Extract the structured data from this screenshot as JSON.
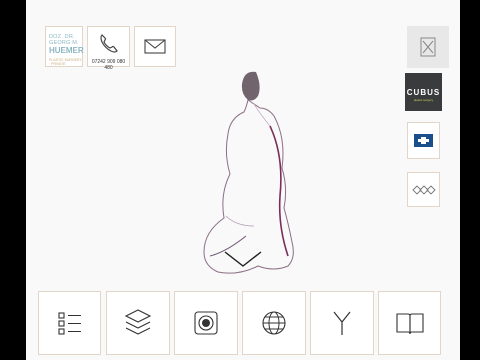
{
  "header": {
    "logo": {
      "line1": "DOZ. DR.",
      "line2": "GEORG M.",
      "line3": "HUEMER",
      "tagline": "PLASTIC SURGERY · PRIVATE"
    },
    "phone_number": "07242 909 080 480"
  },
  "sidebar_right": {
    "close_icon": "close-icon",
    "brands": [
      {
        "name": "CUBUS",
        "subtitle": "plastic surgery"
      },
      {
        "icon": "cross-badge-icon"
      },
      {
        "icon": "diamonds-logo-icon"
      }
    ]
  },
  "bottom_nav": [
    {
      "icon": "list-icon"
    },
    {
      "icon": "layers-icon"
    },
    {
      "icon": "record-icon"
    },
    {
      "icon": "globe-icon"
    },
    {
      "icon": "fork-icon"
    },
    {
      "icon": "book-icon"
    }
  ],
  "colors": {
    "tile_border": "#e3d6c8",
    "accent_blue": "#8db7c4",
    "brand_dark": "#3a3b3d",
    "icon_dark": "#333333"
  }
}
